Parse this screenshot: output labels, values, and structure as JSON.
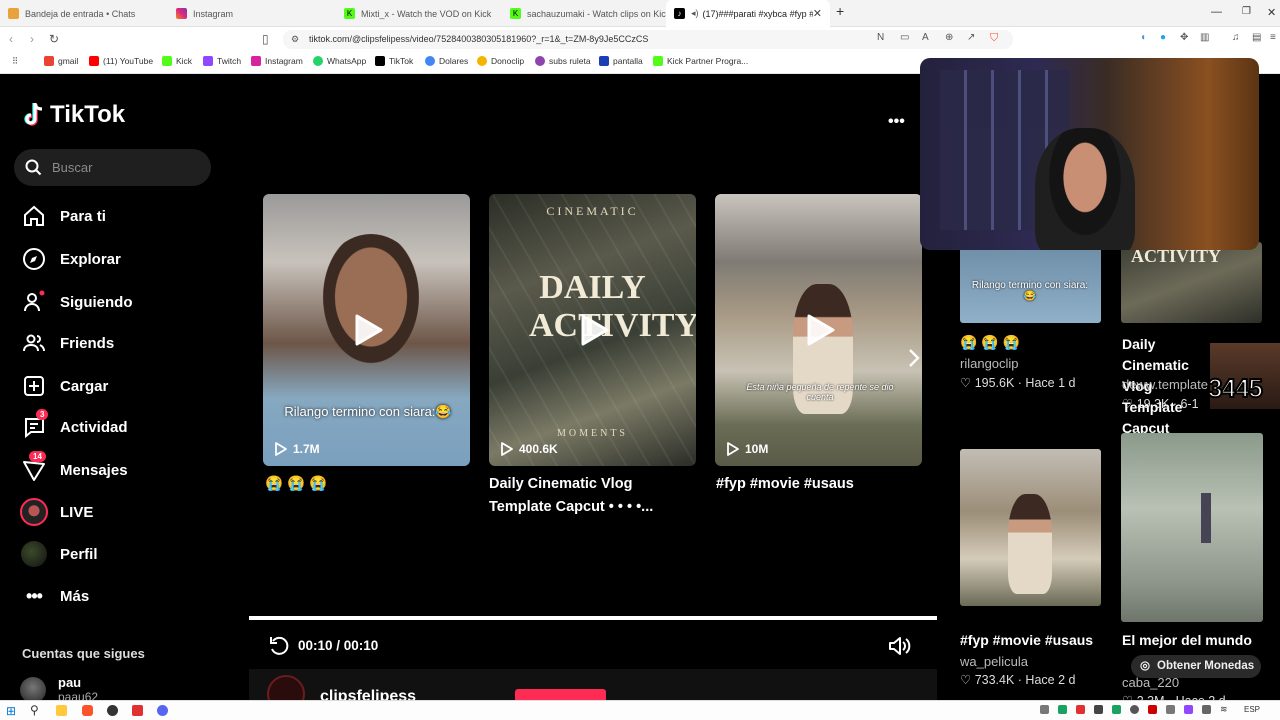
{
  "browser": {
    "tabs": [
      {
        "title": "Bandeja de entrada • Chats",
        "color": "#e9a23b",
        "glyph": "✉"
      },
      {
        "title": "Instagram",
        "color": "#d6249f",
        "glyph": ""
      },
      {
        "title": "Mixti_x - Watch the VOD on Kick",
        "color": "#53fc18",
        "glyph": "K"
      },
      {
        "title": "sachauzumaki - Watch clips on Kick",
        "color": "#53fc18",
        "glyph": "K"
      },
      {
        "title": "(17)###parati #xybca #fyp #",
        "color": "#000000",
        "glyph": "♪"
      }
    ],
    "url": "tiktok.com/@clipsfelipess/video/7528400380305181960?_r=1&_t=ZM-8y9Je5CCzCS",
    "bookmarks": [
      {
        "label": "gmail",
        "color": "#ea4335"
      },
      {
        "label": "(11) YouTube",
        "color": "#ff0000"
      },
      {
        "label": "Kick",
        "color": "#53fc18"
      },
      {
        "label": "Twitch",
        "color": "#9146ff"
      },
      {
        "label": "Instagram",
        "color": "#d6249f"
      },
      {
        "label": "WhatsApp",
        "color": "#25d366"
      },
      {
        "label": "TikTok",
        "color": "#000000"
      },
      {
        "label": "Dolares",
        "color": "#4285f4"
      },
      {
        "label": "Donoclip",
        "color": "#f4b400"
      },
      {
        "label": "subs ruleta",
        "color": "#8e44ad"
      },
      {
        "label": "pantalla",
        "color": "#1a3fb5"
      },
      {
        "label": "Kick Partner Progra...",
        "color": "#53fc18"
      }
    ]
  },
  "tiktok": {
    "logo_text": "TikTok",
    "search_placeholder": "Buscar",
    "nav": [
      {
        "label": "Para ti",
        "icon": "home-icon"
      },
      {
        "label": "Explorar",
        "icon": "compass-icon"
      },
      {
        "label": "Siguiendo",
        "icon": "following-icon"
      },
      {
        "label": "Friends",
        "icon": "friends-icon"
      },
      {
        "label": "Cargar",
        "icon": "upload-icon"
      },
      {
        "label": "Actividad",
        "icon": "activity-icon",
        "badge": "3"
      },
      {
        "label": "Mensajes",
        "icon": "messages-icon",
        "badge": "14"
      },
      {
        "label": "LIVE",
        "icon": "live-icon"
      },
      {
        "label": "Perfil",
        "icon": "profile-icon"
      },
      {
        "label": "Más",
        "icon": "more-icon"
      }
    ],
    "following_header": "Cuentas que sigues",
    "following": [
      {
        "name": "pau",
        "handle": "paau62"
      }
    ],
    "more_menu": "•••",
    "videos": [
      {
        "views": "1.7M",
        "title": "😭 😭 😭",
        "caption": "Rilango termino con siara:😂"
      },
      {
        "views": "400.6K",
        "title": "Daily Cinematic Vlog Template Capcut • • • •...",
        "overlay_top": "CINEMATIC",
        "overlay_main": "DAILY ACTIVITY",
        "overlay_bottom": "MOMENTS"
      },
      {
        "views": "10M",
        "title": "#fyp #movie #usaus",
        "caption": "Esta niña pequeña de repente se dio cuenta"
      }
    ],
    "player": {
      "time": "00:10 / 00:10",
      "progress": 1.0
    },
    "author": "clipsfelipess",
    "side_videos": [
      {
        "title": "😭 😭 😭",
        "user": "rilangoclip",
        "likes": "195.6K",
        "age": "Hace 1 d",
        "caption": "Rilango termino con siara:😂"
      },
      {
        "title": "Daily Cinematic Vlog Template Capcut",
        "user": "deww.template",
        "likes": "19.3K",
        "age": "6-1",
        "overlay": "ACTIVITY"
      },
      {
        "title": "#fyp #movie #usaus",
        "user": "wa_pelicula",
        "likes": "733.4K",
        "age": "Hace 2 d"
      },
      {
        "title": "El mejor del mundo",
        "user": "caba_220",
        "likes": "2.3M",
        "age": "Hace 2 d"
      }
    ],
    "coins_button": "Obtener Monedas",
    "overlay_number": "3445"
  },
  "taskbar": {
    "lang": "ESP"
  }
}
